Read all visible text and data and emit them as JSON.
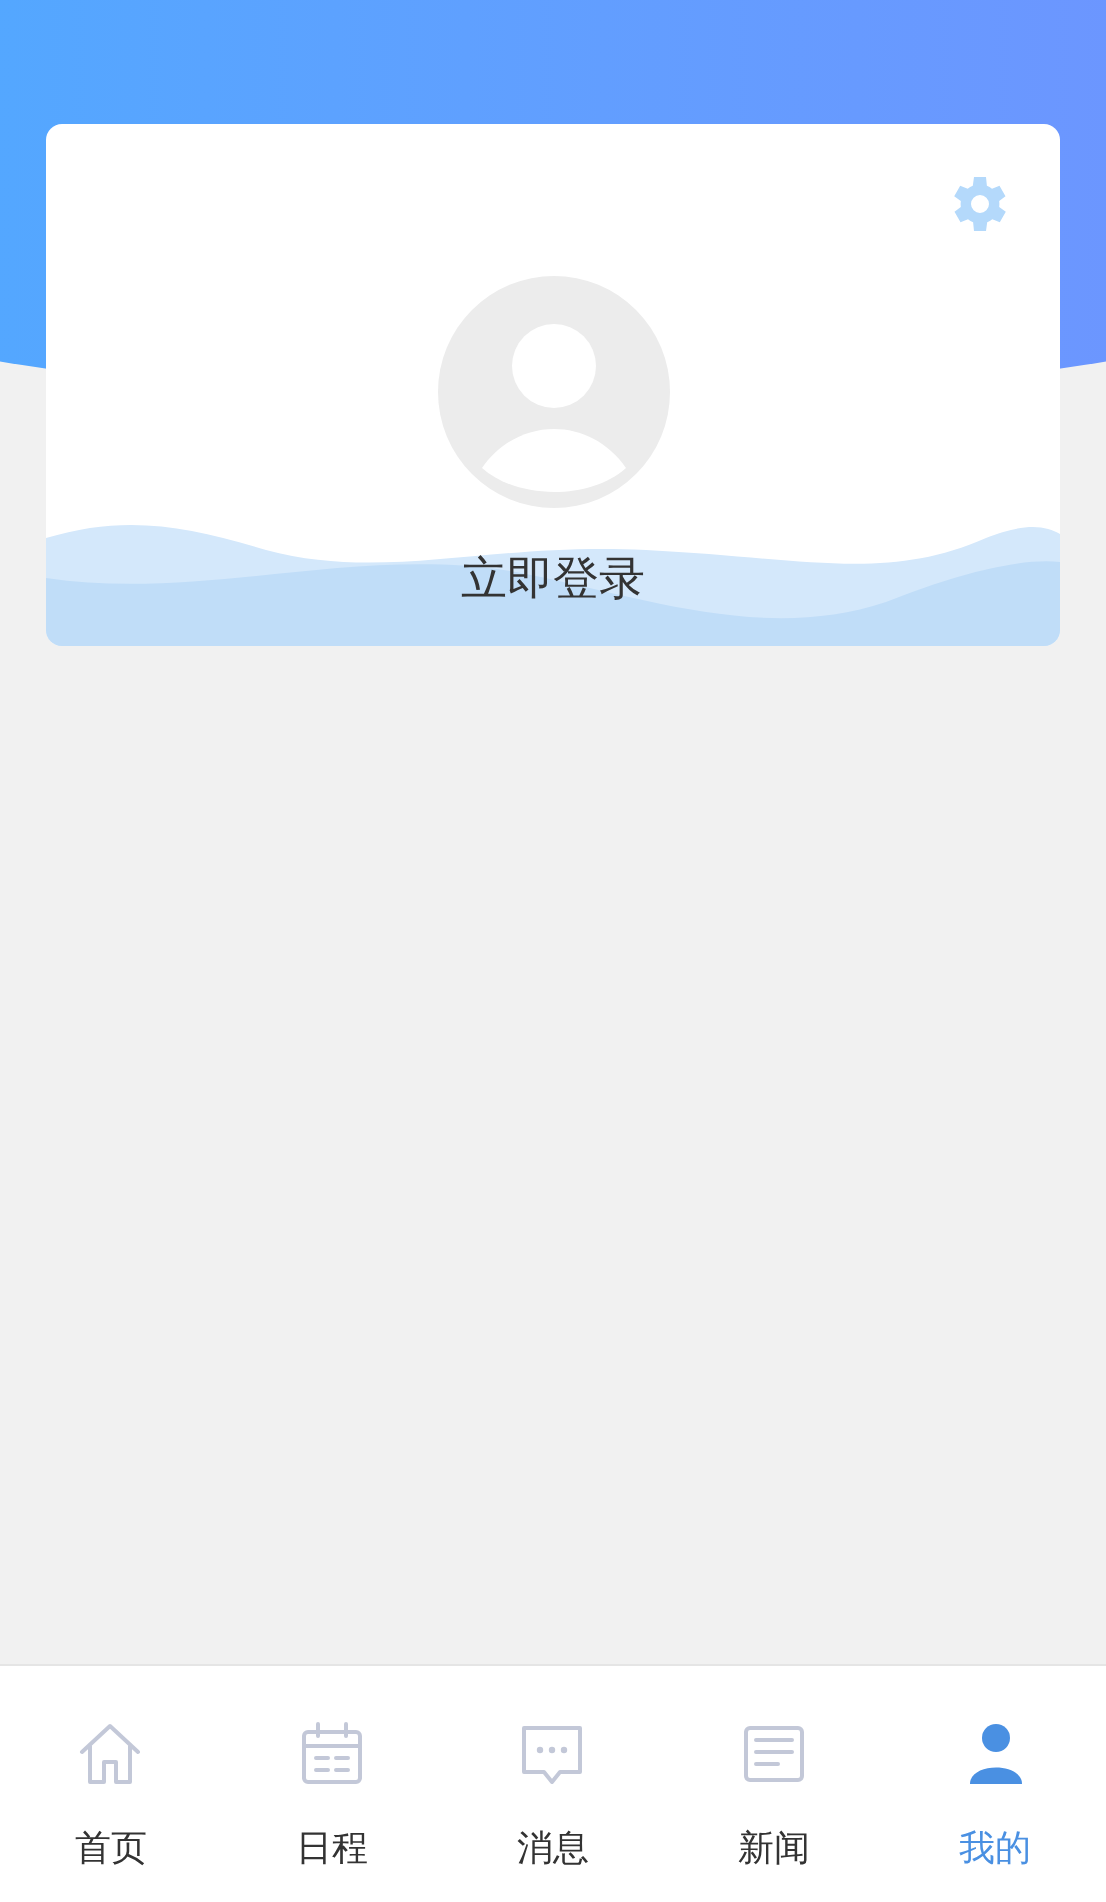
{
  "profile_card": {
    "login_label": "立即登录"
  },
  "tab_bar": [
    {
      "label": "首页",
      "kind": "home",
      "selected": false
    },
    {
      "label": "日程",
      "kind": "calendar",
      "selected": false
    },
    {
      "label": "消息",
      "kind": "message",
      "selected": false
    },
    {
      "label": "新闻",
      "kind": "news",
      "selected": false
    },
    {
      "label": "我的",
      "kind": "person",
      "selected": true
    }
  ]
}
